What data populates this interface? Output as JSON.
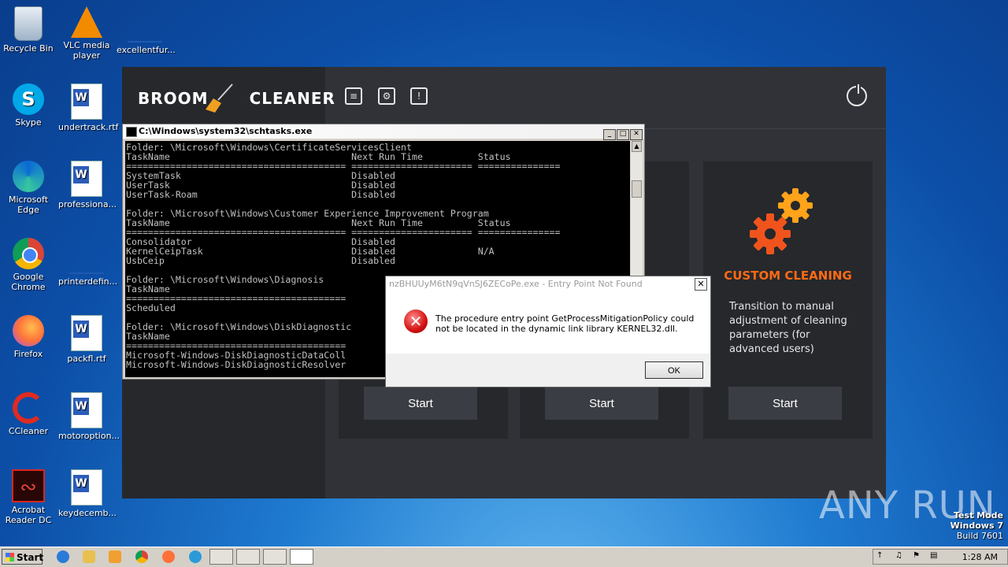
{
  "desktop_icons": [
    {
      "label": "Recycle Bin",
      "icon": "recycle-bin-icon"
    },
    {
      "label": "VLC media player",
      "icon": "vlc-icon"
    },
    {
      "label": "excellentfur...",
      "icon": "file-icon"
    },
    {
      "label": "Skype",
      "icon": "skype-icon"
    },
    {
      "label": "undertrack.rtf",
      "icon": "word-doc-icon"
    },
    {
      "label": "Microsoft Edge",
      "icon": "edge-icon"
    },
    {
      "label": "professiona...",
      "icon": "word-doc-icon"
    },
    {
      "label": "Google Chrome",
      "icon": "chrome-icon"
    },
    {
      "label": "printerdefin...",
      "icon": "file-icon"
    },
    {
      "label": "Firefox",
      "icon": "firefox-icon"
    },
    {
      "label": "packfl.rtf",
      "icon": "word-doc-icon"
    },
    {
      "label": "CCleaner",
      "icon": "ccleaner-icon"
    },
    {
      "label": "motoroption...",
      "icon": "word-doc-icon"
    },
    {
      "label": "Acrobat Reader DC",
      "icon": "acrobat-icon"
    },
    {
      "label": "keydecemb...",
      "icon": "word-doc-icon"
    }
  ],
  "app": {
    "logo_left": "BROOM",
    "logo_right": "CLEANER",
    "card_title": "CUSTOM CLEANING",
    "card_desc": "Transition to manual adjustment of cleaning parameters (for advanced users)",
    "start_label": "Start",
    "accent": "#ff6a13"
  },
  "cmd": {
    "title": "C:\\Windows\\system32\\schtasks.exe",
    "output": "Folder: \\Microsoft\\Windows\\CertificateServicesClient\nTaskName                                 Next Run Time          Status\n======================================== ====================== ===============\nSystemTask                               Disabled\nUserTask                                 Disabled\nUserTask-Roam                            Disabled\n\nFolder: \\Microsoft\\Windows\\Customer Experience Improvement Program\nTaskName                                 Next Run Time          Status\n======================================== ====================== ===============\nConsolidator                             Disabled\nKernelCeipTask                           Disabled               N/A\nUsbCeip                                  Disabled\n\nFolder: \\Microsoft\\Windows\\Diagnosis\nTaskName\n========================================\nScheduled\n\nFolder: \\Microsoft\\Windows\\DiskDiagnostic\nTaskName\n========================================\nMicrosoft-Windows-DiskDiagnosticDataColl\nMicrosoft-Windows-DiskDiagnosticResolver"
  },
  "dialog": {
    "title": "nzBHUUyM6tN9qVnSJ6ZECoPe.exe - Entry Point Not Found",
    "message": "The procedure entry point GetProcessMitigationPolicy could not be located in the dynamic link library KERNEL32.dll.",
    "ok_label": "OK"
  },
  "watermark": "ANY RUN",
  "test_mode": {
    "line1": "Test Mode",
    "line2": "Windows 7",
    "line3": "Build 7601"
  },
  "taskbar": {
    "start_label": "Start",
    "clock": "1:28 AM"
  }
}
